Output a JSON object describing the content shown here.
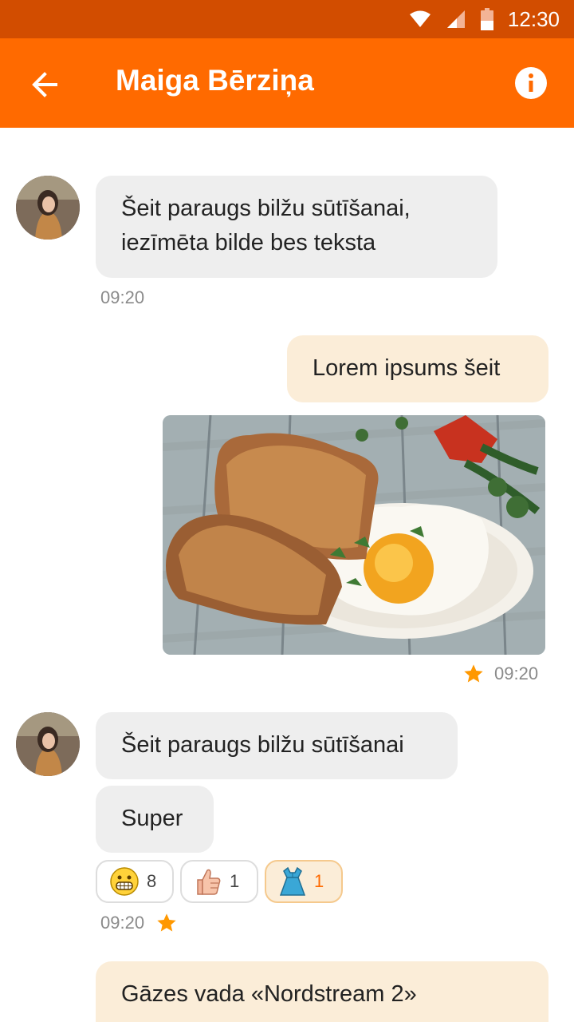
{
  "status_bar": {
    "time": "12:30"
  },
  "app_bar": {
    "title": "Maiga Bērziņa"
  },
  "messages": [
    {
      "text": "Šeit paraugs bilžu sūtīšanai,\niezīmēta bilde bes teksta",
      "time": "09:20"
    },
    {
      "text": "Lorem ipsums šeit"
    },
    {
      "time": "09:20"
    },
    {
      "text": "Šeit paraugs bilžu sūtīšanai"
    },
    {
      "text": "Super",
      "time": "09:20"
    },
    {
      "text": "Gāzes vada «Nordstream 2»"
    }
  ],
  "reactions": [
    {
      "emoji": "grinning-face",
      "count": "8"
    },
    {
      "emoji": "thumbs-up",
      "count": "1"
    },
    {
      "emoji": "dress",
      "count": "1",
      "active": true
    }
  ],
  "colors": {
    "accent": "#ff6a00",
    "status_bar": "#d24d00",
    "incoming_bubble": "#eeeeee",
    "outgoing_bubble": "#fbedd8",
    "star": "#ff9800"
  }
}
